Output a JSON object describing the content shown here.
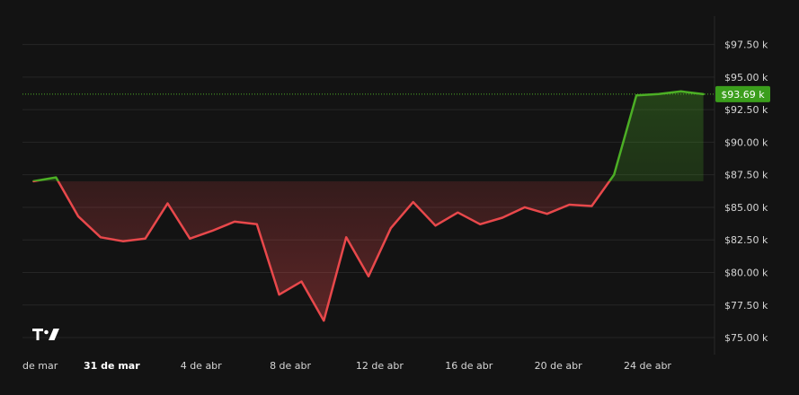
{
  "chart_data": {
    "type": "line",
    "currency_format": "$",
    "y_ticks": [
      75000,
      77500,
      80000,
      82500,
      85000,
      87500,
      90000,
      92500,
      95000,
      97500
    ],
    "y_tick_labels": [
      "$75.00 k",
      "$77.50 k",
      "$80.00 k",
      "$82.50 k",
      "$85.00 k",
      "$87.50 k",
      "$90.00 k",
      "$92.50 k",
      "$95.00 k",
      "$97.50 k"
    ],
    "ylim": [
      73900,
      99400
    ],
    "x_ticks": [
      {
        "label": "de mar",
        "day": 0,
        "bold": false
      },
      {
        "label": "31 de mar",
        "day": 4,
        "bold": true
      },
      {
        "label": "4 de abr",
        "day": 8,
        "bold": false
      },
      {
        "label": "8 de abr",
        "day": 12,
        "bold": false
      },
      {
        "label": "12 de abr",
        "day": 16,
        "bold": false
      },
      {
        "label": "16 de abr",
        "day": 20,
        "bold": false
      },
      {
        "label": "20 de abr",
        "day": 24,
        "bold": false
      },
      {
        "label": "24 de abr",
        "day": 28,
        "bold": false
      }
    ],
    "xlim": [
      0,
      31
    ],
    "baseline": 87000,
    "current_price": 93690,
    "current_price_label": "$93.69 k",
    "series": [
      {
        "values": [
          87000,
          87300,
          84300,
          82700,
          82400,
          82600,
          85300,
          82600,
          83200,
          83900,
          83700,
          78300,
          79300,
          76300,
          82700,
          79700,
          83400,
          85400,
          83600,
          84600,
          83700,
          84200,
          85000,
          84500,
          85200,
          85100,
          87500,
          93600,
          93700,
          93900,
          93690
        ],
        "days": [
          0.5,
          1.5,
          2.5,
          3.5,
          4.5,
          5.5,
          6.5,
          7.5,
          8.5,
          9.5,
          10.5,
          11.5,
          12.5,
          13.5,
          14.5,
          15.5,
          16.5,
          17.5,
          18.5,
          19.5,
          20.5,
          21.5,
          22.5,
          23.5,
          24.5,
          25.5,
          26.5,
          27.5,
          28.5,
          29.5,
          30.5
        ]
      }
    ],
    "colors": {
      "up": "#4caf25",
      "down": "#e8484b",
      "badge": "#3b9e1c",
      "background": "#131313"
    }
  },
  "watermark": "logo-icon"
}
